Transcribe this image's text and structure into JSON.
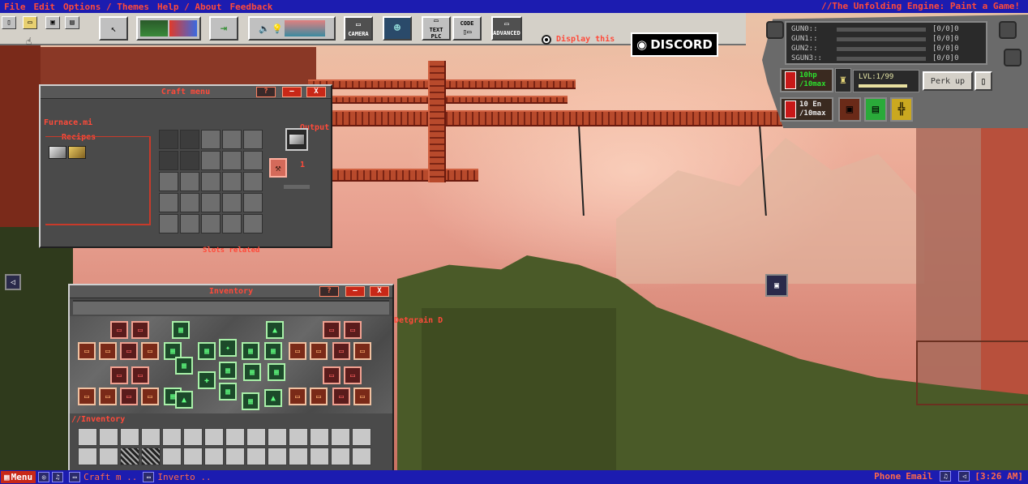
{
  "menu": {
    "items": [
      "File",
      "Edit",
      "Options / Themes",
      "Help / About",
      "Feedback"
    ],
    "app_title": "//The Unfolding Engine: Paint a Game!"
  },
  "toolbar": {
    "camera_label": "CAMERA",
    "textplc_label": "TEXT PLC",
    "code_label": "CODE",
    "advanced_label": "ADVANCED",
    "display_label": "Display this",
    "discord_label": "DISCORD"
  },
  "hud": {
    "guns": [
      {
        "name": "GUN0::",
        "value": "[0/0]0"
      },
      {
        "name": "GUN1::",
        "value": "[0/0]0"
      },
      {
        "name": "GUN2::",
        "value": "[0/0]0"
      },
      {
        "name": "SGUN3::",
        "value": "[0/0]0"
      }
    ],
    "hp_line1": "10hp",
    "hp_line2": "/10max",
    "en_line1": "10 En",
    "en_line2": "/10max",
    "level": "LVL:1/99",
    "perk_label": "Perk up"
  },
  "craft": {
    "title": "Craft menu",
    "help": "?",
    "minimize": "—",
    "close": "X",
    "furnace_label": "Furnace.mi",
    "recipes_label": "Recipes",
    "output_label": "Output",
    "count": "1",
    "behind_label": "Slots related"
  },
  "inventory": {
    "title": "Inventory",
    "help": "?",
    "minimize": "—",
    "close": "X",
    "section_label": "//Inventory",
    "side_label": "Detgrain D"
  },
  "taskbar": {
    "menu_label": "Menu",
    "items": [
      "Craft m ..",
      "Inverto .."
    ],
    "phone": "Phone",
    "email": "Email",
    "clock": "[3:26 AM]"
  },
  "colors": {
    "menubar_bg": "#1c1cb0",
    "accent_red": "#ff4a3a",
    "hp_green": "#2de02d"
  }
}
